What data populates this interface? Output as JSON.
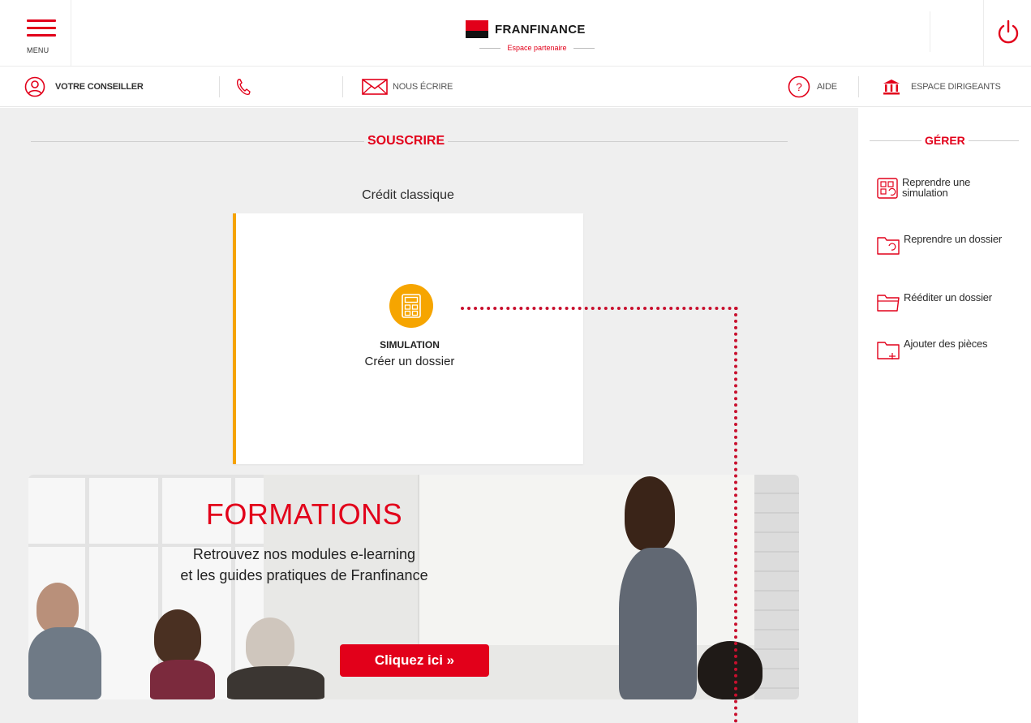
{
  "header": {
    "menu_label": "MENU",
    "brand_name": "FRANFINANCE",
    "brand_subtitle": "Espace partenaire"
  },
  "subnav": {
    "advisor": "VOTRE CONSEILLER",
    "write": "NOUS ÉCRIRE",
    "help": "AIDE",
    "directors": "ESPACE DIRIGEANTS"
  },
  "main": {
    "section_title": "SOUSCRIRE",
    "credit_label": "Crédit classique",
    "card": {
      "title": "SIMULATION",
      "subtitle": "Créer un dossier"
    },
    "banner": {
      "title": "FORMATIONS",
      "line1": "Retrouvez nos modules e-learning",
      "line2": "et les guides pratiques de Franfinance",
      "cta": "Cliquez ici  »"
    }
  },
  "sidebar": {
    "title": "GÉRER",
    "items": [
      {
        "label": "Reprendre une simulation",
        "icon": "simulation-icon"
      },
      {
        "label": "Reprendre un dossier",
        "icon": "folder-resume-icon"
      },
      {
        "label": "Rééditer un dossier",
        "icon": "folder-edit-icon"
      },
      {
        "label": "Ajouter des pièces",
        "icon": "folder-add-icon"
      }
    ]
  },
  "colors": {
    "brand_red": "#e2001a",
    "accent_orange": "#f5a300",
    "background": "#efefef"
  }
}
